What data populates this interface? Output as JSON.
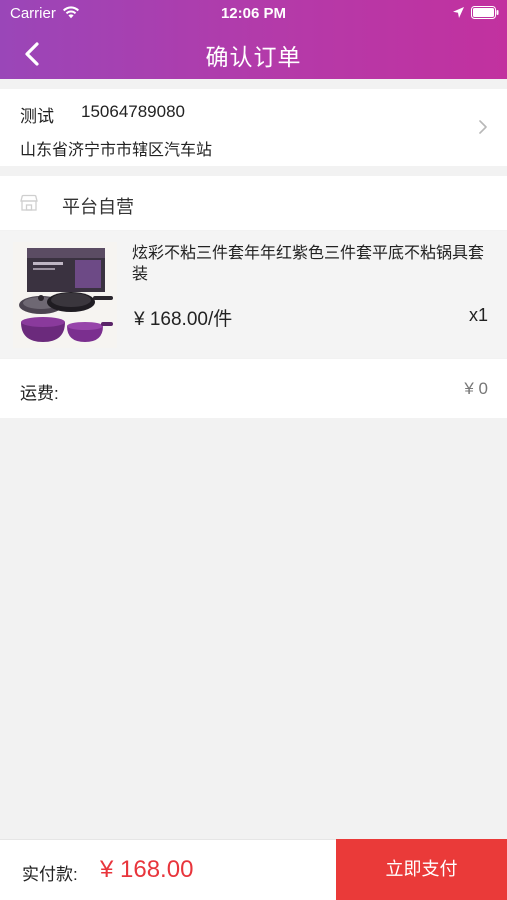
{
  "status_bar": {
    "carrier": "Carrier",
    "time": "12:06 PM"
  },
  "nav": {
    "title": "确认订单",
    "back_icon": "chevron-left-icon"
  },
  "address": {
    "name": "测试",
    "phone": "15064789080",
    "detail": "山东省济宁市市辖区汽车站",
    "chevron_icon": "chevron-right-icon"
  },
  "shop": {
    "icon": "shop-icon",
    "name": "平台自营"
  },
  "product": {
    "title": "炫彩不粘三件套年年红紫色三件套平底不粘锅具套装",
    "price": "¥ 168.00/件",
    "quantity": "x1"
  },
  "shipping": {
    "label": "运费:",
    "value": "¥ 0"
  },
  "footer": {
    "total_label": "实付款:",
    "total_value": "¥ 168.00",
    "pay_button": "立即支付"
  },
  "colors": {
    "header_gradient_start": "#9a46b8",
    "header_gradient_end": "#c2319f",
    "accent_red": "#ea3a39",
    "price_red": "#e8353c"
  }
}
